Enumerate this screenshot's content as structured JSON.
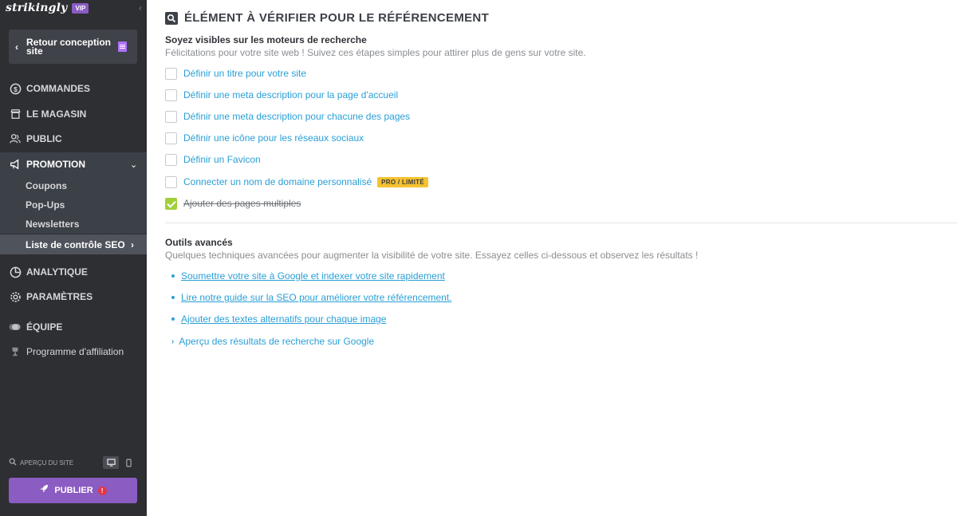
{
  "app": {
    "logo": "strikingly",
    "badge": "VIP",
    "collapse_icon": "chevron-left-icon"
  },
  "sidebar": {
    "back_button": {
      "label": "Retour conception site",
      "icon": "page-icon"
    },
    "items": [
      {
        "label": "COMMANDES",
        "icon": "dollar-circle-icon"
      },
      {
        "label": "LE MAGASIN",
        "icon": "store-icon"
      },
      {
        "label": "PUBLIC",
        "icon": "users-icon"
      },
      {
        "label": "PROMOTION",
        "icon": "megaphone-icon",
        "expanded": true
      },
      {
        "label": "ANALYTIQUE",
        "icon": "pie-chart-icon"
      },
      {
        "label": "PARAMÈTRES",
        "icon": "gear-icon"
      },
      {
        "label": "ÉQUIPE",
        "icon": "team-icon"
      },
      {
        "label": "Programme d'affiliation",
        "icon": "trophy-icon"
      }
    ],
    "promotion_sub": [
      {
        "label": "Coupons"
      },
      {
        "label": "Pop-Ups"
      },
      {
        "label": "Newsletters"
      },
      {
        "label": "Liste de contrôle SEO",
        "current": true
      }
    ],
    "preview": {
      "label": "APERÇU DU SITE"
    },
    "publish": {
      "label": "PUBLIER",
      "alert": "!"
    }
  },
  "main": {
    "title": "ÉLÉMENT À VÉRIFIER POUR LE RÉFÉRENCEMENT",
    "visible_section": {
      "title": "Soyez visibles sur les moteurs de recherche",
      "subtitle": "Félicitations pour votre site web ! Suivez ces étapes simples pour attirer plus de gens sur votre site.",
      "checklist": [
        {
          "label": "Définir un titre pour votre site",
          "checked": false
        },
        {
          "label": "Définir une meta description pour la page d'accueil",
          "checked": false
        },
        {
          "label": "Définir une meta description pour chacune des pages",
          "checked": false
        },
        {
          "label": "Définir une icône pour les réseaux sociaux",
          "checked": false
        },
        {
          "label": "Définir un Favicon",
          "checked": false
        },
        {
          "label": "Connecter un nom de domaine personnalisé",
          "checked": false,
          "badge": "PRO / LIMITÉ"
        },
        {
          "label": "Ajouter des pages multiples",
          "checked": true
        }
      ]
    },
    "advanced_section": {
      "title": "Outils avancés",
      "subtitle": "Quelques techniques avancées pour augmenter la visibilité de votre site. Essayez celles ci-dessous et observez les résultats !",
      "links": [
        "Soumettre votre site à Google et indexer votre site rapidement",
        "Lire notre guide sur la SEO pour améliorer votre référencement.",
        "Ajouter des textes alternatifs pour chaque image"
      ],
      "toggle": "Aperçu des résultats de recherche sur Google"
    }
  }
}
